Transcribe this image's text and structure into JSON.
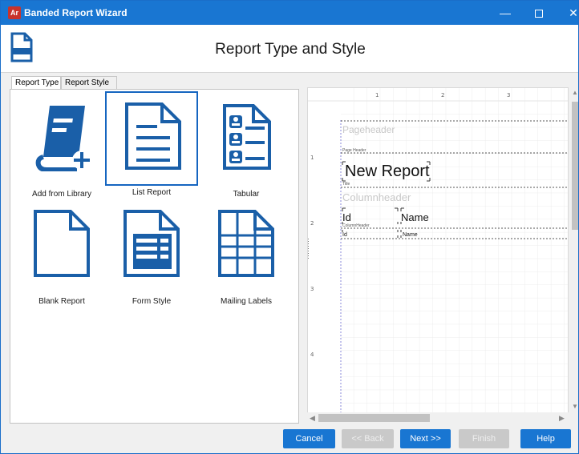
{
  "window": {
    "app_icon_text": "Ar",
    "title": "Banded Report Wizard",
    "minimize_glyph": "—",
    "close_glyph": "✕"
  },
  "header": {
    "title": "Report Type and Style"
  },
  "tabs": [
    {
      "label": "Report Type",
      "active": true
    },
    {
      "label": "Report Style",
      "active": false
    }
  ],
  "report_types": [
    {
      "label": "Add from Library",
      "icon": "library-book-icon",
      "selected": false
    },
    {
      "label": "List Report",
      "icon": "list-report-icon",
      "selected": true
    },
    {
      "label": "Tabular",
      "icon": "tabular-icon",
      "selected": false
    },
    {
      "label": "Blank Report",
      "icon": "blank-report-icon",
      "selected": false
    },
    {
      "label": "Form Style",
      "icon": "form-style-icon",
      "selected": false
    },
    {
      "label": "Mailing Labels",
      "icon": "mailing-labels-icon",
      "selected": false
    }
  ],
  "preview": {
    "ruler_top": [
      "1",
      "2",
      "3"
    ],
    "ruler_left": [
      "1",
      "2",
      "3",
      "4"
    ],
    "sections": {
      "page_header_watermark": "Pageheader",
      "page_header_label": "Page Header",
      "report_title": "New Report",
      "title_label": "Title",
      "column_header_watermark": "Columnheader",
      "column_header_label": "ColumnHeader"
    },
    "columns": [
      {
        "header": "Id",
        "detail": "Id"
      },
      {
        "header": "Name",
        "detail": "Name"
      }
    ]
  },
  "footer": {
    "cancel": "Cancel",
    "back": "<< Back",
    "next": "Next >>",
    "finish": "Finish",
    "help": "Help"
  },
  "colors": {
    "accent": "#1976d2",
    "icon_blue": "#1a5fa8",
    "disabled": "#c9c9c9"
  }
}
